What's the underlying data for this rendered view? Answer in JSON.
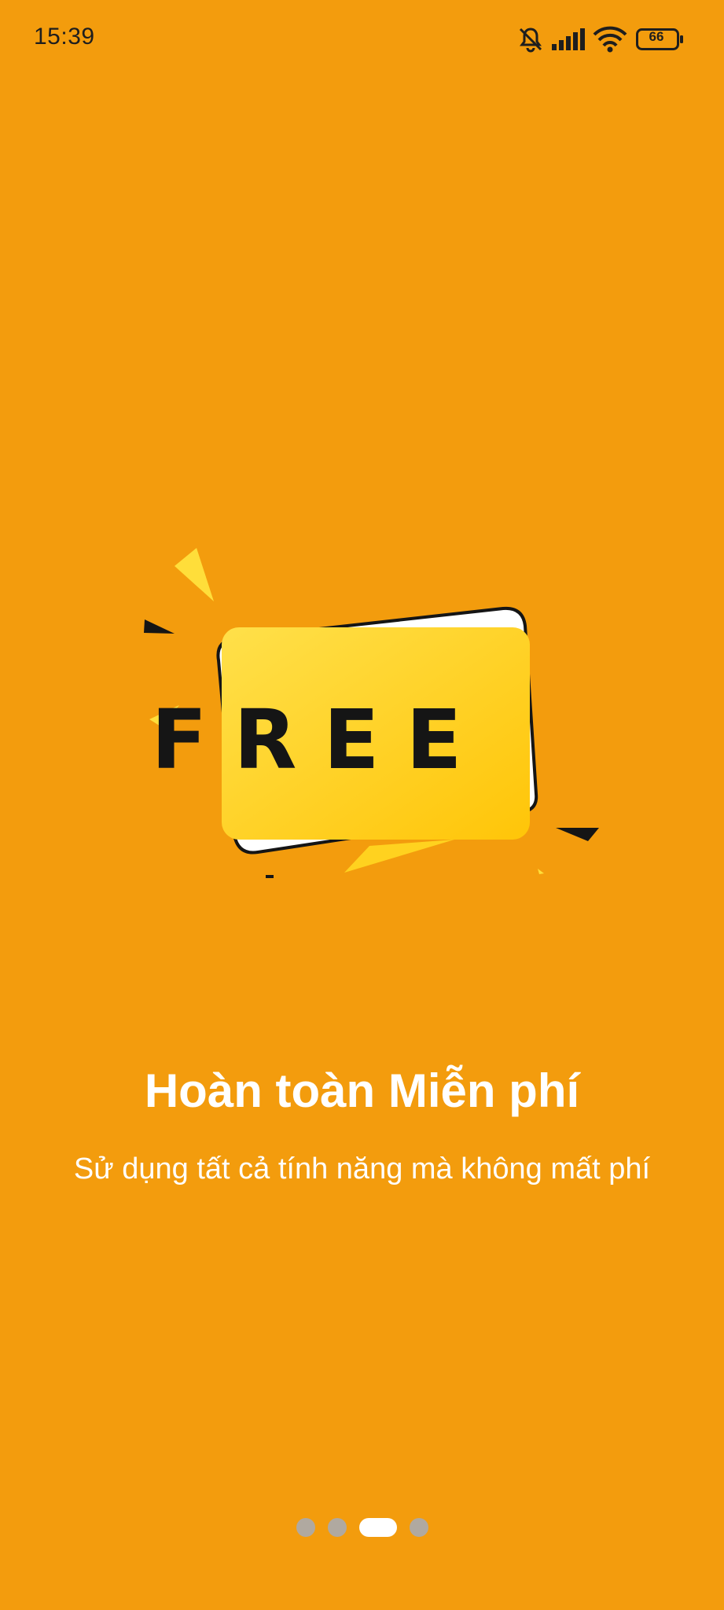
{
  "colors": {
    "background": "#F39C0D",
    "card_yellow": "#FFD21F",
    "text_white": "#FFFFFF",
    "dot_inactive": "#B0A9A0",
    "dot_active": "#FFFFFF"
  },
  "status_bar": {
    "time": "15:39",
    "battery": "66",
    "icons": [
      "bell-muted-icon",
      "signal-icon",
      "wifi-icon",
      "battery-icon"
    ]
  },
  "illustration": {
    "badge_text": "FREE"
  },
  "onboarding": {
    "title": "Hoàn toàn Miễn phí",
    "subtitle": "Sử dụng tất cả tính năng mà không mất phí"
  },
  "pager": {
    "count": 4,
    "active_index": 2
  }
}
